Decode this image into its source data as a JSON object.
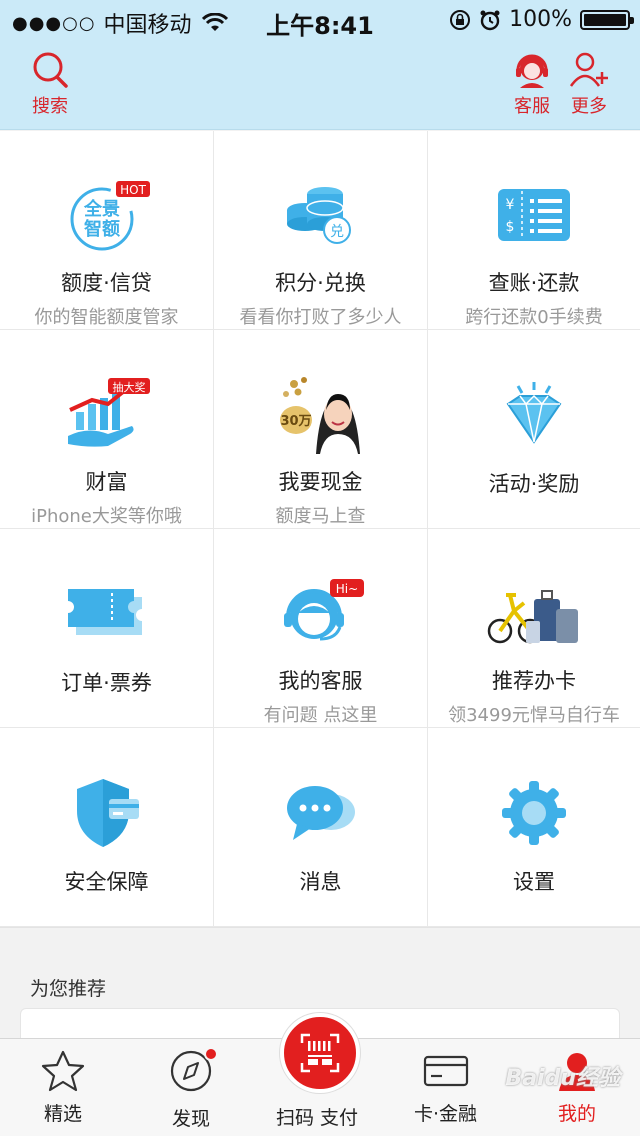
{
  "status_bar": {
    "signal_dots": "●●●○○",
    "carrier": "中国移动",
    "time": "上午8:41",
    "battery_percent": "100%",
    "battery_level": 1.0
  },
  "header": {
    "search_label": "搜索",
    "service_label": "客服",
    "more_label": "更多",
    "accent_color": "#d8262c"
  },
  "grid": [
    {
      "title": "额度·信贷",
      "subtitle": "你的智能额度管家",
      "icon": "quota-badge-icon",
      "badge": "HOT",
      "icon_text": "全景智额"
    },
    {
      "title": "积分·兑换",
      "subtitle": "看看你打败了多少人",
      "icon": "coins-exchange-icon",
      "icon_text": "兑"
    },
    {
      "title": "查账·还款",
      "subtitle": "跨行还款0手续费",
      "icon": "bill-icon"
    },
    {
      "title": "财富",
      "subtitle": "iPhone大奖等你哦",
      "icon": "wealth-chart-icon",
      "badge": "抽大奖"
    },
    {
      "title": "我要现金",
      "subtitle": "额度马上查",
      "icon": "cash-promo-image",
      "icon_text": "30万"
    },
    {
      "title": "活动·奖励",
      "subtitle": "",
      "icon": "diamond-icon"
    },
    {
      "title": "订单·票券",
      "subtitle": "",
      "icon": "ticket-icon"
    },
    {
      "title": "我的客服",
      "subtitle": "有问题 点这里",
      "icon": "customer-service-icon",
      "badge": "Hi~"
    },
    {
      "title": "推荐办卡",
      "subtitle": "领3499元悍马自行车",
      "icon": "bike-luggage-image"
    },
    {
      "title": "安全保障",
      "subtitle": "",
      "icon": "shield-card-icon"
    },
    {
      "title": "消息",
      "subtitle": "",
      "icon": "message-bubble-icon"
    },
    {
      "title": "设置",
      "subtitle": "",
      "icon": "gear-icon"
    }
  ],
  "recommend": {
    "title": "为您推荐"
  },
  "tabbar": {
    "tabs": [
      {
        "label": "精选",
        "icon": "star-icon"
      },
      {
        "label": "发现",
        "icon": "compass-icon"
      },
      {
        "label": "扫码 支付",
        "icon": "scan-pay-icon"
      },
      {
        "label": "卡·金融",
        "icon": "card-icon"
      },
      {
        "label": "我的",
        "icon": "user-icon",
        "active": true
      }
    ],
    "active_color": "#e21f1f"
  },
  "watermark": "Baidu经验"
}
